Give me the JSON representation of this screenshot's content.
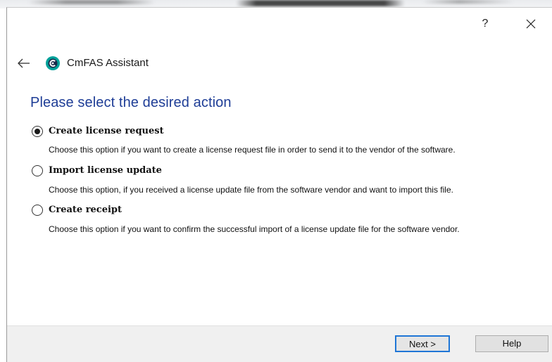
{
  "window": {
    "help_symbol": "?",
    "close_icon": "close-icon"
  },
  "header": {
    "back_icon": "back-arrow-icon",
    "logo_icon": "cmfas-logo-icon",
    "app_title": "CmFAS Assistant"
  },
  "main": {
    "page_title": "Please select the desired action",
    "options": [
      {
        "label": "Create license request",
        "description": "Choose this option if you want to create a license request file in order to send it to the vendor of the software.",
        "selected": true
      },
      {
        "label": "Import license update",
        "description": "Choose this option, if you received a license update file from the software vendor and want to import this file.",
        "selected": false
      },
      {
        "label": "Create receipt",
        "description": "Choose this option if you want to confirm the successful import of a license update file for the software vendor.",
        "selected": false
      }
    ]
  },
  "footer": {
    "next_label": "Next >",
    "help_label": "Help"
  },
  "colors": {
    "title_blue": "#1e3d96",
    "logo_teal": "#00a19a",
    "focus_blue": "#1f76d6",
    "footer_bg": "#f0f0f0"
  }
}
